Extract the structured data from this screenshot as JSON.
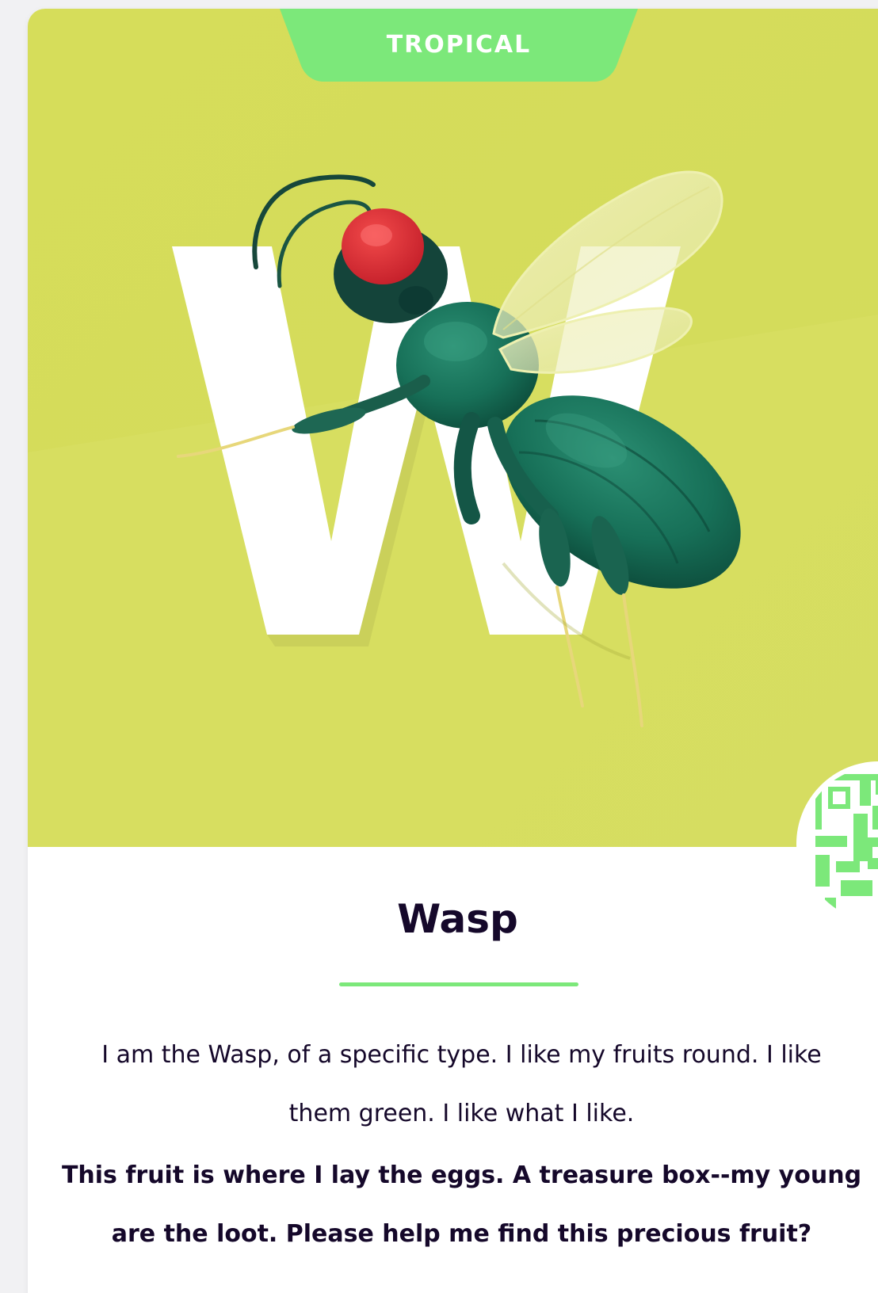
{
  "card": {
    "category_label": "TROPICAL",
    "title": "Wasp",
    "paragraphs": [
      "I am the Wasp, of a specific type. I like my fruits round. I like them green. I like what I like.",
      "This fruit is where I lay the eggs. A treasure box--my young are the loot. Please help me find this precious fruit?"
    ]
  },
  "hero": {
    "letter": "W",
    "illustration": "wasp-illustration",
    "background_color": "#d8df5e"
  },
  "badge": {
    "icon": "qr-code-icon",
    "color": "#7ce87a"
  },
  "colors": {
    "accent": "#7ce87a",
    "text": "#15082a",
    "card_background": "#ffffff",
    "page_background": "#f1f1f3"
  }
}
